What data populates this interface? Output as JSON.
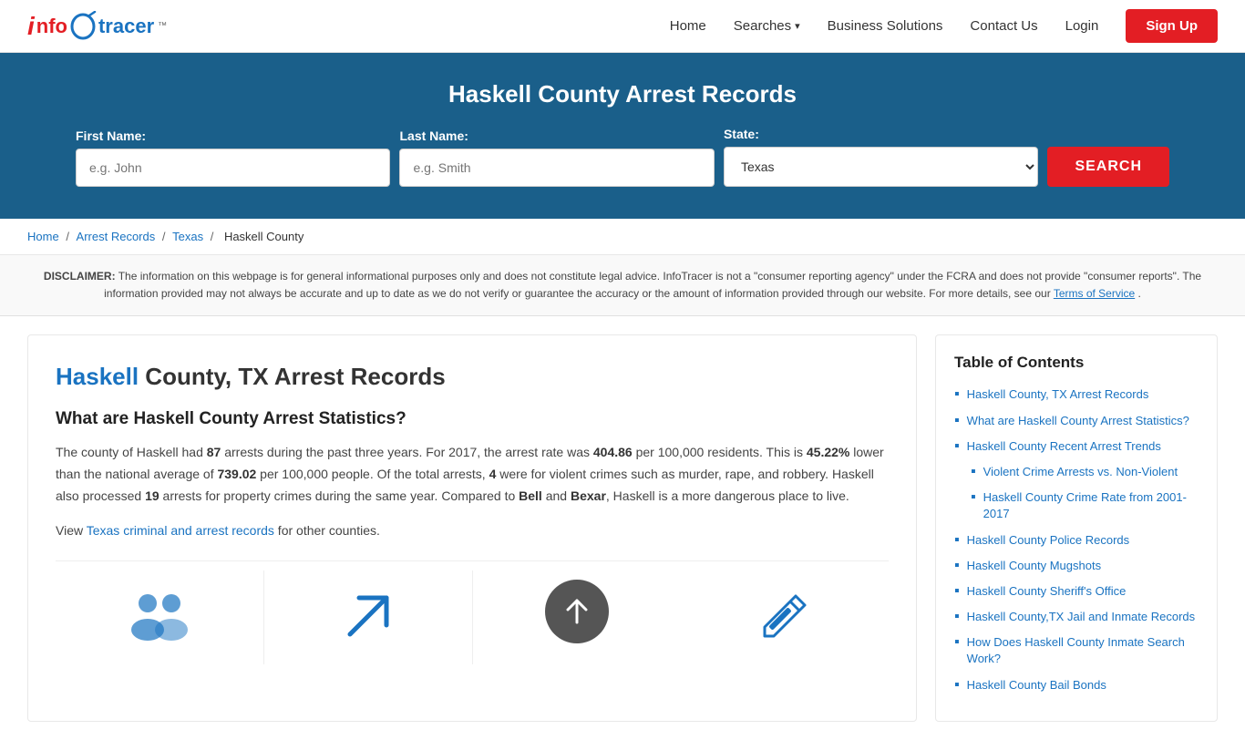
{
  "header": {
    "logo_alt": "InfoTracer",
    "nav": {
      "home": "Home",
      "searches": "Searches",
      "business_solutions": "Business Solutions",
      "contact_us": "Contact Us",
      "login": "Login",
      "signup": "Sign Up"
    }
  },
  "hero": {
    "title": "Haskell County Arrest Records",
    "first_name_label": "First Name:",
    "first_name_placeholder": "e.g. John",
    "last_name_label": "Last Name:",
    "last_name_placeholder": "e.g. Smith",
    "state_label": "State:",
    "state_value": "Texas",
    "search_button": "SEARCH"
  },
  "breadcrumb": {
    "home": "Home",
    "arrest_records": "Arrest Records",
    "texas": "Texas",
    "current": "Haskell County"
  },
  "disclaimer": {
    "label": "DISCLAIMER:",
    "text": " The information on this webpage is for general informational purposes only and does not constitute legal advice. InfoTracer is not a \"consumer reporting agency\" under the FCRA and does not provide \"consumer reports\". The information provided may not always be accurate and up to date as we do not verify or guarantee the accuracy or the amount of information provided through our website. For more details, see our ",
    "tos_link": "Terms of Service",
    "period": "."
  },
  "article": {
    "title_highlight": "Haskell",
    "title_rest": " County, TX Arrest Records",
    "section1_heading": "What are Haskell County Arrest Statistics?",
    "section1_p1_before": "The county of Haskell had ",
    "arrests_count": "87",
    "section1_p1_mid": " arrests during the past three years. For 2017, the arrest rate was ",
    "arrest_rate": "404.86",
    "section1_p1_after": " per 100,000 residents. This is ",
    "lower_pct": "45.22%",
    "section1_p1_mid2": " lower than the national average of ",
    "national_avg": "739.02",
    "section1_p1_mid3": " per 100,000 people. Of the total arrests, ",
    "violent_count": "4",
    "section1_p1_mid4": " were for violent crimes such as murder, rape, and robbery. Haskell also processed ",
    "property_count": "19",
    "section1_p1_end": " arrests for property crimes during the same year. Compared to ",
    "compare1": "Bell",
    "compare_and": " and ",
    "compare2": "Bexar",
    "section1_p1_final": ", Haskell is a more dangerous place to live.",
    "view_records_prefix": "View ",
    "view_records_link": "Texas criminal and arrest records",
    "view_records_suffix": " for other counties."
  },
  "toc": {
    "heading": "Table of Contents",
    "items": [
      {
        "label": "Haskell County, TX Arrest Records",
        "sub": false
      },
      {
        "label": "What are Haskell County Arrest Statistics?",
        "sub": false
      },
      {
        "label": "Haskell County Recent Arrest Trends",
        "sub": false
      },
      {
        "label": "Violent Crime Arrests vs. Non-Violent",
        "sub": true
      },
      {
        "label": "Haskell County Crime Rate from 2001-2017",
        "sub": true
      },
      {
        "label": "Haskell County Police Records",
        "sub": false
      },
      {
        "label": "Haskell County Mugshots",
        "sub": false
      },
      {
        "label": "Haskell County Sheriff's Office",
        "sub": false
      },
      {
        "label": "Haskell County,TX Jail and Inmate Records",
        "sub": false
      },
      {
        "label": "How Does Haskell County Inmate Search Work?",
        "sub": false
      },
      {
        "label": "Haskell County Bail Bonds",
        "sub": false
      }
    ]
  },
  "icons": {
    "people": "👥",
    "arrow_up": "↗",
    "dark_circle": "⬆",
    "edit": "✏"
  }
}
